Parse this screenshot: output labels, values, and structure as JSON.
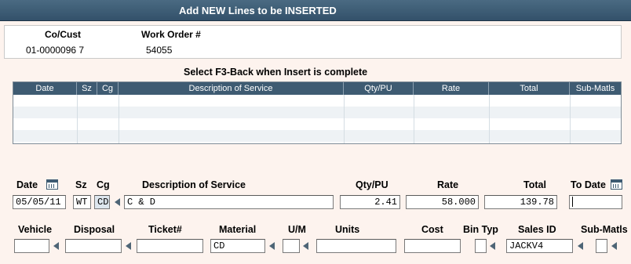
{
  "window": {
    "title": "Add NEW Lines to be INSERTED"
  },
  "header": {
    "cocust_label": "Co/Cust",
    "workorder_label": "Work Order #",
    "cocust_value": "01-0000096 7",
    "workorder_value": "54055"
  },
  "instruction": "Select F3-Back when Insert is complete",
  "grid": {
    "columns": [
      "Date",
      "Sz",
      "Cg",
      "Description of Service",
      "Qty/PU",
      "Rate",
      "Total",
      "Sub-Matls"
    ],
    "rows": []
  },
  "form1": {
    "date_label": "Date",
    "sz_label": "Sz",
    "cg_label": "Cg",
    "desc_label": "Description of Service",
    "qty_label": "Qty/PU",
    "rate_label": "Rate",
    "total_label": "Total",
    "todate_label": "To Date",
    "date_value": "05/05/11",
    "sz_value": "WT",
    "cg_value": "CD",
    "desc_value": "C & D",
    "qty_value": "2.41",
    "rate_value": "58.000",
    "total_value": "139.78",
    "todate_value": ""
  },
  "form2": {
    "vehicle_label": "Vehicle",
    "disposal_label": "Disposal",
    "ticket_label": "Ticket#",
    "material_label": "Material",
    "um_label": "U/M",
    "units_label": "Units",
    "cost_label": "Cost",
    "bintyp_label": "Bin Typ",
    "salesid_label": "Sales ID",
    "submatls_label": "Sub-Matls",
    "vehicle_value": "",
    "disposal_value": "",
    "ticket_value": "",
    "material_value": "CD",
    "um_value": "",
    "units_value": "",
    "cost_value": "",
    "bintyp_value": "",
    "salesid_value": "JACKV4",
    "submatls_value": ""
  },
  "colors": {
    "titlebar": "#3e5b72",
    "background": "#fdf3ee",
    "grid_header": "#3e5b72",
    "grid_stripe": "#eef2f5"
  }
}
